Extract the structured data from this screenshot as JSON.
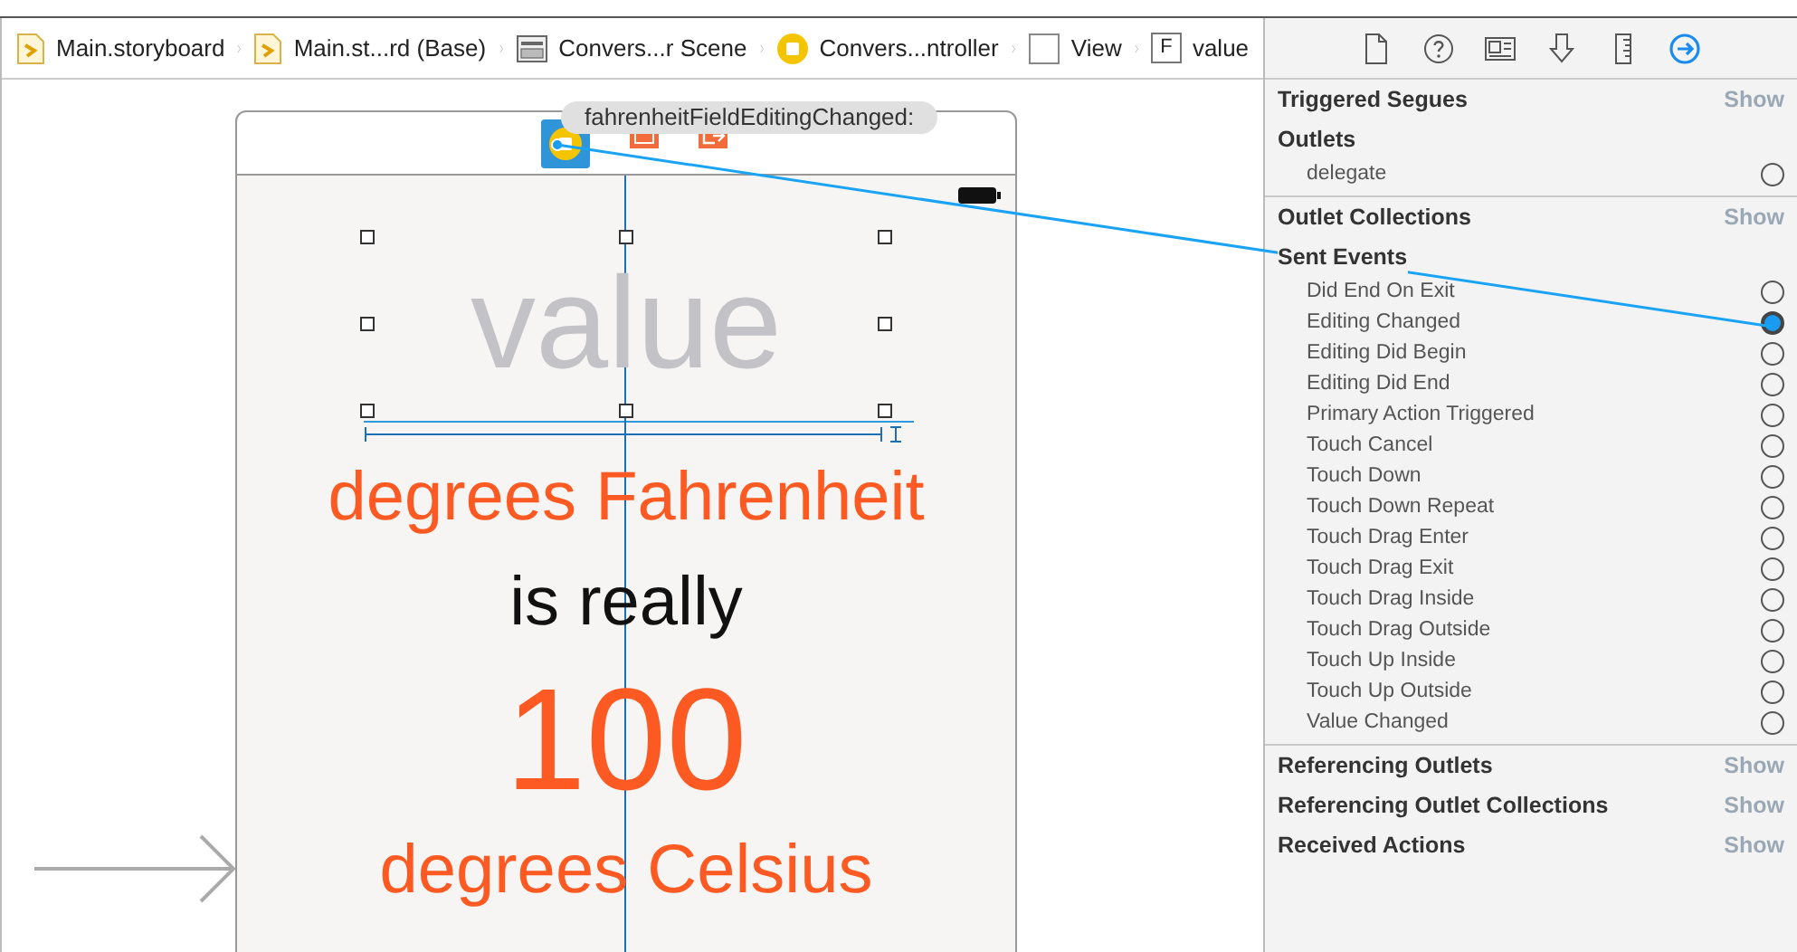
{
  "breadcrumbs": [
    {
      "kind": "storyboard",
      "label": "Main.storyboard"
    },
    {
      "kind": "storyboard",
      "label": "Main.st...rd (Base)"
    },
    {
      "kind": "scene",
      "label": "Convers...r Scene"
    },
    {
      "kind": "controller",
      "label": "Convers...ntroller"
    },
    {
      "kind": "view",
      "label": "View"
    },
    {
      "kind": "field",
      "badge": "F",
      "label": "value"
    }
  ],
  "canvas": {
    "tooltip": "fahrenheitFieldEditingChanged:",
    "text_field": {
      "placeholder": "value"
    },
    "labels": [
      {
        "text": "degrees Fahrenheit",
        "color": "#fc5a22",
        "kind": "caption"
      },
      {
        "text": "is really",
        "color": "#111111",
        "kind": "caption"
      },
      {
        "text": "100",
        "color": "#fc5a22",
        "kind": "number"
      },
      {
        "text": "degrees Celsius",
        "color": "#fc5a22",
        "kind": "caption"
      }
    ]
  },
  "inspector": {
    "tabs": [
      {
        "kind": "file",
        "selected": false
      },
      {
        "kind": "help",
        "selected": false
      },
      {
        "kind": "identity",
        "selected": false
      },
      {
        "kind": "attributes",
        "selected": false
      },
      {
        "kind": "size",
        "selected": false
      },
      {
        "kind": "connections",
        "selected": true
      }
    ],
    "sections": [
      {
        "title": "Triggered Segues",
        "action": "Show"
      },
      {
        "title": "Outlets",
        "items": [
          {
            "label": "delegate",
            "connected": false
          }
        ]
      },
      {
        "title": "Outlet Collections",
        "action": "Show"
      },
      {
        "title": "Sent Events",
        "items": [
          {
            "label": "Did End On Exit",
            "connected": false
          },
          {
            "label": "Editing Changed",
            "connected": true
          },
          {
            "label": "Editing Did Begin",
            "connected": false
          },
          {
            "label": "Editing Did End",
            "connected": false
          },
          {
            "label": "Primary Action Triggered",
            "connected": false
          },
          {
            "label": "Touch Cancel",
            "connected": false
          },
          {
            "label": "Touch Down",
            "connected": false
          },
          {
            "label": "Touch Down Repeat",
            "connected": false
          },
          {
            "label": "Touch Drag Enter",
            "connected": false
          },
          {
            "label": "Touch Drag Exit",
            "connected": false
          },
          {
            "label": "Touch Drag Inside",
            "connected": false
          },
          {
            "label": "Touch Drag Outside",
            "connected": false
          },
          {
            "label": "Touch Up Inside",
            "connected": false
          },
          {
            "label": "Touch Up Outside",
            "connected": false
          },
          {
            "label": "Value Changed",
            "connected": false
          }
        ]
      },
      {
        "title": "Referencing Outlets",
        "action": "Show"
      },
      {
        "title": "Referencing Outlet Collections",
        "action": "Show"
      },
      {
        "title": "Received Actions",
        "action": "Show"
      }
    ]
  }
}
